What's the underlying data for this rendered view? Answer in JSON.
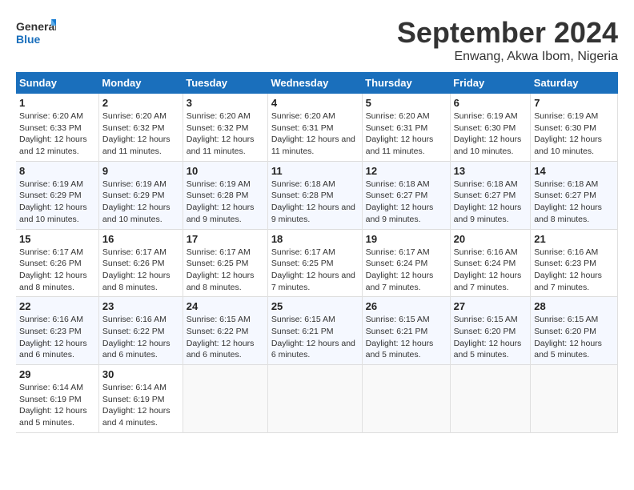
{
  "logo": {
    "line1": "General",
    "line2": "Blue"
  },
  "title": "September 2024",
  "location": "Enwang, Akwa Ibom, Nigeria",
  "days_of_week": [
    "Sunday",
    "Monday",
    "Tuesday",
    "Wednesday",
    "Thursday",
    "Friday",
    "Saturday"
  ],
  "weeks": [
    [
      {
        "day": "1",
        "sunrise": "6:20 AM",
        "sunset": "6:33 PM",
        "daylight": "12 hours and 12 minutes."
      },
      {
        "day": "2",
        "sunrise": "6:20 AM",
        "sunset": "6:32 PM",
        "daylight": "12 hours and 11 minutes."
      },
      {
        "day": "3",
        "sunrise": "6:20 AM",
        "sunset": "6:32 PM",
        "daylight": "12 hours and 11 minutes."
      },
      {
        "day": "4",
        "sunrise": "6:20 AM",
        "sunset": "6:31 PM",
        "daylight": "12 hours and 11 minutes."
      },
      {
        "day": "5",
        "sunrise": "6:20 AM",
        "sunset": "6:31 PM",
        "daylight": "12 hours and 11 minutes."
      },
      {
        "day": "6",
        "sunrise": "6:19 AM",
        "sunset": "6:30 PM",
        "daylight": "12 hours and 10 minutes."
      },
      {
        "day": "7",
        "sunrise": "6:19 AM",
        "sunset": "6:30 PM",
        "daylight": "12 hours and 10 minutes."
      }
    ],
    [
      {
        "day": "8",
        "sunrise": "6:19 AM",
        "sunset": "6:29 PM",
        "daylight": "12 hours and 10 minutes."
      },
      {
        "day": "9",
        "sunrise": "6:19 AM",
        "sunset": "6:29 PM",
        "daylight": "12 hours and 10 minutes."
      },
      {
        "day": "10",
        "sunrise": "6:19 AM",
        "sunset": "6:28 PM",
        "daylight": "12 hours and 9 minutes."
      },
      {
        "day": "11",
        "sunrise": "6:18 AM",
        "sunset": "6:28 PM",
        "daylight": "12 hours and 9 minutes."
      },
      {
        "day": "12",
        "sunrise": "6:18 AM",
        "sunset": "6:27 PM",
        "daylight": "12 hours and 9 minutes."
      },
      {
        "day": "13",
        "sunrise": "6:18 AM",
        "sunset": "6:27 PM",
        "daylight": "12 hours and 9 minutes."
      },
      {
        "day": "14",
        "sunrise": "6:18 AM",
        "sunset": "6:27 PM",
        "daylight": "12 hours and 8 minutes."
      }
    ],
    [
      {
        "day": "15",
        "sunrise": "6:17 AM",
        "sunset": "6:26 PM",
        "daylight": "12 hours and 8 minutes."
      },
      {
        "day": "16",
        "sunrise": "6:17 AM",
        "sunset": "6:26 PM",
        "daylight": "12 hours and 8 minutes."
      },
      {
        "day": "17",
        "sunrise": "6:17 AM",
        "sunset": "6:25 PM",
        "daylight": "12 hours and 8 minutes."
      },
      {
        "day": "18",
        "sunrise": "6:17 AM",
        "sunset": "6:25 PM",
        "daylight": "12 hours and 7 minutes."
      },
      {
        "day": "19",
        "sunrise": "6:17 AM",
        "sunset": "6:24 PM",
        "daylight": "12 hours and 7 minutes."
      },
      {
        "day": "20",
        "sunrise": "6:16 AM",
        "sunset": "6:24 PM",
        "daylight": "12 hours and 7 minutes."
      },
      {
        "day": "21",
        "sunrise": "6:16 AM",
        "sunset": "6:23 PM",
        "daylight": "12 hours and 7 minutes."
      }
    ],
    [
      {
        "day": "22",
        "sunrise": "6:16 AM",
        "sunset": "6:23 PM",
        "daylight": "12 hours and 6 minutes."
      },
      {
        "day": "23",
        "sunrise": "6:16 AM",
        "sunset": "6:22 PM",
        "daylight": "12 hours and 6 minutes."
      },
      {
        "day": "24",
        "sunrise": "6:15 AM",
        "sunset": "6:22 PM",
        "daylight": "12 hours and 6 minutes."
      },
      {
        "day": "25",
        "sunrise": "6:15 AM",
        "sunset": "6:21 PM",
        "daylight": "12 hours and 6 minutes."
      },
      {
        "day": "26",
        "sunrise": "6:15 AM",
        "sunset": "6:21 PM",
        "daylight": "12 hours and 5 minutes."
      },
      {
        "day": "27",
        "sunrise": "6:15 AM",
        "sunset": "6:20 PM",
        "daylight": "12 hours and 5 minutes."
      },
      {
        "day": "28",
        "sunrise": "6:15 AM",
        "sunset": "6:20 PM",
        "daylight": "12 hours and 5 minutes."
      }
    ],
    [
      {
        "day": "29",
        "sunrise": "6:14 AM",
        "sunset": "6:19 PM",
        "daylight": "12 hours and 5 minutes."
      },
      {
        "day": "30",
        "sunrise": "6:14 AM",
        "sunset": "6:19 PM",
        "daylight": "12 hours and 4 minutes."
      },
      null,
      null,
      null,
      null,
      null
    ]
  ],
  "labels": {
    "sunrise": "Sunrise:",
    "sunset": "Sunset:",
    "daylight": "Daylight:"
  }
}
